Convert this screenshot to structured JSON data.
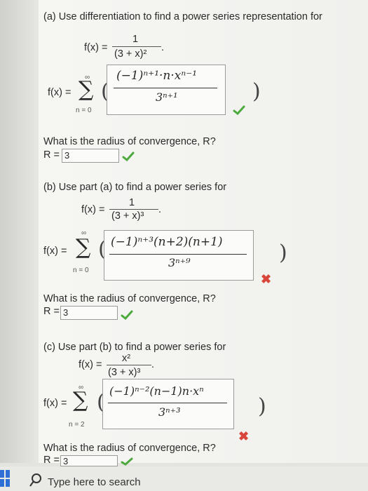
{
  "part_a": {
    "question": "(a) Use differentiation to find a power series representation for",
    "fx_label": "f(x) =",
    "numerator": "1",
    "denominator": "(3 + x)²",
    "period": ".",
    "series_lhs": "f(x) =",
    "sum_top": "∞",
    "sum_bottom": "n = 0",
    "answer_numerator": "(−1)ⁿ⁺¹·n·xⁿ⁻¹",
    "answer_denominator": "3ⁿ⁺¹",
    "status": "correct",
    "radius_question": "What is the radius of convergence, R?",
    "radius_label": "R =",
    "radius_value": "3",
    "radius_status": "correct"
  },
  "part_b": {
    "question": "(b) Use part (a) to find a power series for",
    "fx_label": "f(x) =",
    "numerator": "1",
    "denominator": "(3 + x)³",
    "period": ".",
    "series_lhs": "f(x) =",
    "sum_top": "∞",
    "sum_bottom": "n = 0",
    "answer_numerator": "(−1)ⁿ⁺³(n+2)(n+1)",
    "answer_denominator": "3ⁿ⁺⁹",
    "status": "incorrect",
    "radius_question": "What is the radius of convergence, R?",
    "radius_label": "R =",
    "radius_value": "3",
    "radius_status": "correct"
  },
  "part_c": {
    "question": "(c) Use part (b) to find a power series for",
    "fx_label": "f(x) =",
    "numerator": "x²",
    "denominator": "(3 + x)³",
    "period": ".",
    "series_lhs": "f(x) =",
    "sum_top": "∞",
    "sum_bottom": "n = 2",
    "answer_numerator": "(−1)ⁿ⁻²(n−1)n·xⁿ",
    "answer_denominator": "3ⁿ⁺³",
    "status": "incorrect",
    "radius_question": "What is the radius of convergence, R?",
    "radius_label": "R =",
    "radius_value": "3",
    "radius_status": "correct"
  },
  "taskbar": {
    "search_placeholder": "Type here to search"
  },
  "colors": {
    "correct": "#4caa3c",
    "incorrect": "#d9463c"
  }
}
